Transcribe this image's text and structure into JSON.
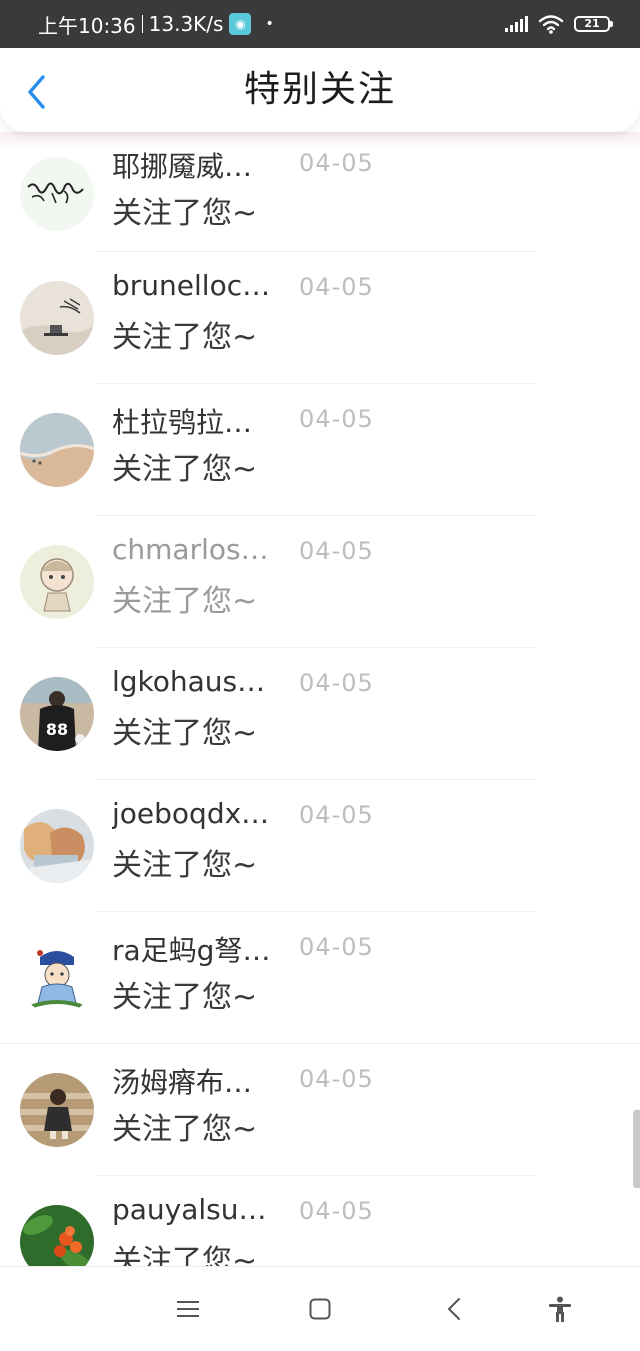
{
  "status_bar": {
    "time": "上午10:36",
    "net_speed": "13.3K/s",
    "battery": "21",
    "icons": [
      "app-notification-icon",
      "signal-icon",
      "wifi-icon",
      "battery-icon"
    ]
  },
  "header": {
    "title": "特别关注",
    "back_icon": "chevron-left-icon"
  },
  "accent_color": "#2a8ef0",
  "notifications": [
    {
      "name": "耶挪魇威…",
      "date": "04-05",
      "message": "关注了您~",
      "avatar": "calligraphy-avatar"
    },
    {
      "name": "brunelloc…",
      "date": "04-05",
      "message": "关注了您~",
      "avatar": "ink-painting-avatar"
    },
    {
      "name": "杜拉鸮拉…",
      "date": "04-05",
      "message": "关注了您~",
      "avatar": "beach-avatar"
    },
    {
      "name": "chmarlos…",
      "date": "04-05",
      "message": "关注了您~",
      "avatar": "cartoon-girl-avatar"
    },
    {
      "name": "lgkohaus…",
      "date": "04-05",
      "message": "关注了您~",
      "avatar": "jersey-88-avatar"
    },
    {
      "name": "joeboqdx…",
      "date": "04-05",
      "message": "关注了您~",
      "avatar": "couple-avatar"
    },
    {
      "name": "ra足蚂g弩…",
      "date": "04-05",
      "message": "关注了您~",
      "avatar": "cartoon-boy-avatar"
    },
    {
      "name": "汤姆瘠布…",
      "date": "04-05",
      "message": "关注了您~",
      "avatar": "stairs-girl-avatar"
    },
    {
      "name": "pauyalsu…",
      "date": "04-05",
      "message": "关注了您~",
      "avatar": "flower-avatar"
    }
  ],
  "nav_bar": {
    "buttons": [
      "menu-icon",
      "home-icon",
      "back-icon",
      "accessibility-icon"
    ]
  }
}
